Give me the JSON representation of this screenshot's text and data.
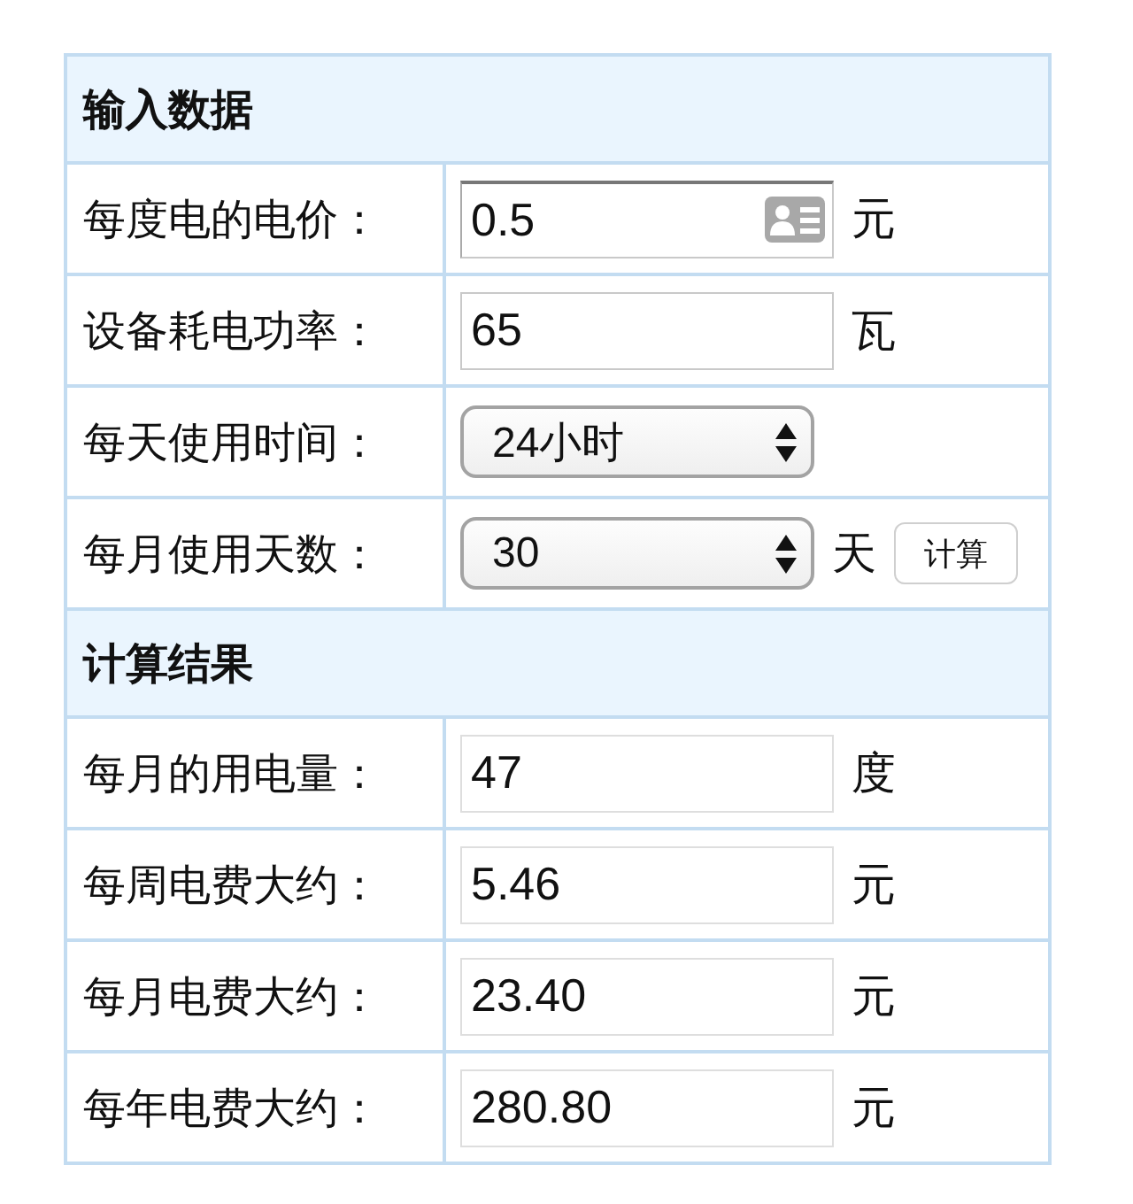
{
  "sections": [
    {
      "title": "输入数据",
      "rows": [
        {
          "kind": "input",
          "label": "每度电的电价：",
          "value": "0.5",
          "unit": "元",
          "autofill": true
        },
        {
          "kind": "input",
          "label": "设备耗电功率：",
          "value": "65",
          "unit": "瓦",
          "autofill": false
        },
        {
          "kind": "select",
          "label": "每天使用时间：",
          "value": "24小时"
        },
        {
          "kind": "select",
          "label": "每月使用天数：",
          "value": "30",
          "unit": "天",
          "button": "计算"
        }
      ]
    },
    {
      "title": "计算结果",
      "rows": [
        {
          "kind": "output",
          "label": "每月的用电量：",
          "value": "47",
          "unit": "度",
          "autofill": false
        },
        {
          "kind": "output",
          "label": "每周电费大约：",
          "value": "5.46",
          "unit": "元",
          "autofill": false
        },
        {
          "kind": "output",
          "label": "每月电费大约：",
          "value": "23.40",
          "unit": "元",
          "autofill": false
        },
        {
          "kind": "output",
          "label": "每年电费大约：",
          "value": "280.80",
          "unit": "元",
          "autofill": false
        }
      ]
    }
  ]
}
